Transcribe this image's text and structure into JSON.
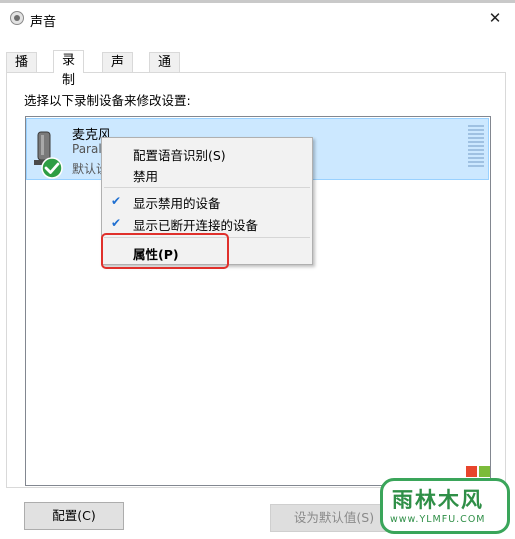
{
  "window": {
    "title": "声音",
    "close_glyph": "✕"
  },
  "tabs": [
    {
      "label": "播放",
      "active": false
    },
    {
      "label": "录制",
      "active": true
    },
    {
      "label": "声音",
      "active": false
    },
    {
      "label": "通信",
      "active": false
    }
  ],
  "instruction": "选择以下录制设备来修改设置:",
  "device": {
    "name": "麦克风",
    "subtitle_visible": "Paral",
    "status_visible": "默认设",
    "icon": "microphone-icon",
    "default_badge": "green-check-icon"
  },
  "context_menu": {
    "items": [
      {
        "label": "配置语音识别(S)",
        "checked": false
      },
      {
        "label": "禁用",
        "checked": false
      },
      {
        "label": "显示禁用的设备",
        "checked": true
      },
      {
        "label": "显示已断开连接的设备",
        "checked": true
      },
      {
        "label": "属性(P)",
        "checked": false,
        "bold": true,
        "highlighted": true
      }
    ],
    "check_glyph": "✔"
  },
  "buttons": {
    "configure": "配置(C)",
    "set_default": "设为默认值(S)",
    "set_default_enabled": false
  },
  "watermark": {
    "text": "雨林木风",
    "url": "www.YLMFU.COM"
  },
  "colors": {
    "selection_bg": "#cce8ff",
    "check_blue": "#1f6fd1",
    "highlight_red": "#e0302b",
    "watermark_green": "#3aa55a"
  }
}
